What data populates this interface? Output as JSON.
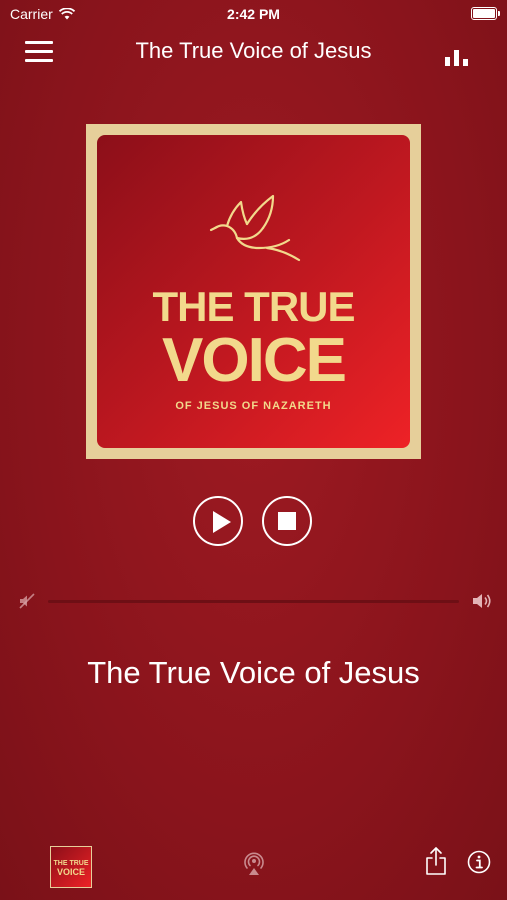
{
  "status_bar": {
    "carrier": "Carrier",
    "time": "2:42 PM"
  },
  "navbar": {
    "title": "The True Voice of Jesus",
    "menu_icon": "hamburger-icon",
    "right_icon": "equalizer-icon"
  },
  "artwork": {
    "line1": "THE TRUE",
    "line2": "VOICE",
    "line3": "OF JESUS OF NAZARETH",
    "logo_icon": "dove-icon"
  },
  "controls": {
    "play_icon": "play-icon",
    "stop_icon": "stop-icon"
  },
  "volume": {
    "level": 0.0
  },
  "now_playing": {
    "title": "The True Voice of Jesus"
  },
  "bottom_bar": {
    "thumb_line1": "THE TRUE",
    "thumb_line2": "VOICE",
    "icons": [
      "airplay-icon",
      "share-icon",
      "info-icon"
    ]
  },
  "colors": {
    "background": "#8a141c",
    "gold": "#f2d98c",
    "frame": "#e6cf9a"
  }
}
